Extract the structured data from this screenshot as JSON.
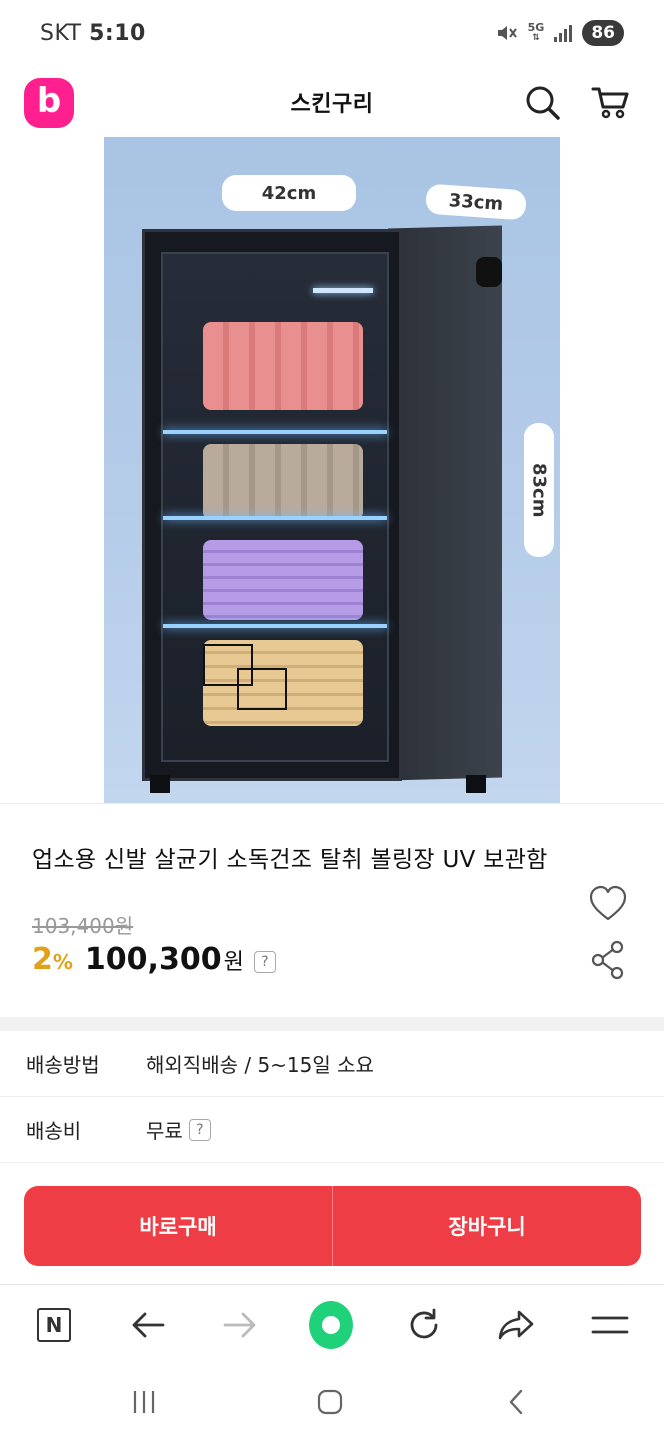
{
  "status_bar": {
    "carrier": "SKT",
    "time": "5:10",
    "network": "5G",
    "battery": "86"
  },
  "header": {
    "logo_letter": "b",
    "title": "스킨구리",
    "icons": [
      "search-icon",
      "cart-icon"
    ]
  },
  "product_image": {
    "width_label": "42cm",
    "depth_label": "33cm",
    "height_label": "83cm"
  },
  "product": {
    "name": "업소용 신발 살균기 소독건조 탈취 볼링장 UV 보관함",
    "original_price": "103,400원",
    "discount_rate": "2",
    "discount_unit": "%",
    "sale_price": "100,300",
    "currency": "원",
    "help_mark": "?"
  },
  "shipping": {
    "method_label": "배송방법",
    "method_value": "해외직배송 / 5~15일 소요",
    "fee_label": "배송비",
    "fee_value": "무료",
    "help_mark": "?"
  },
  "actions": {
    "buy_now": "바로구매",
    "add_to_cart": "장바구니"
  },
  "browser_bar": {
    "n_label": "N",
    "icons": [
      "n-icon",
      "back-arrow-icon",
      "forward-arrow-icon",
      "green-dot-button",
      "refresh-icon",
      "share-arrow-icon",
      "menu-icon"
    ]
  },
  "colors": {
    "brand_pink": "#ff1f8e",
    "buy_red": "#ee3d44",
    "discount_gold": "#e0a21a",
    "green_button": "#1fd27a"
  }
}
